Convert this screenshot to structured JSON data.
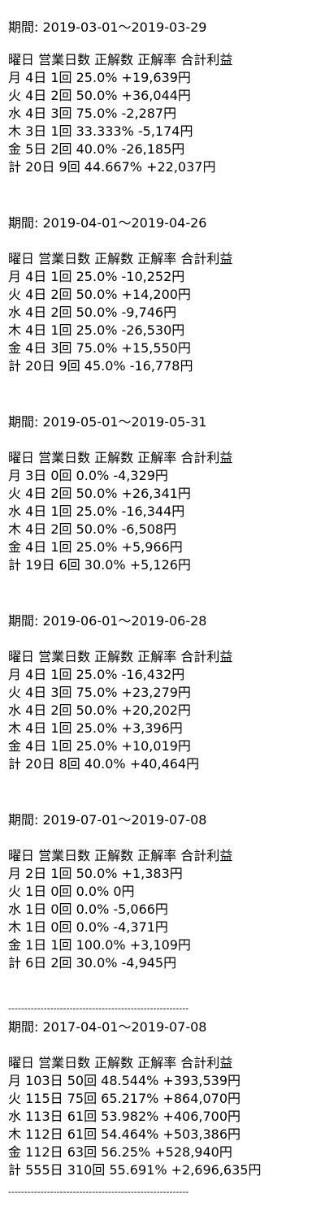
{
  "period_label": "期間:",
  "header": "曜日 営業日数 正解数 正解率 合計利益",
  "separator": "--------------------------------------------------------",
  "sections": [
    {
      "period": "2019-03-01〜2019-03-29",
      "rows": [
        "月 4日 1回 25.0% +19,639円",
        "火 4日 2回 50.0% +36,044円",
        "水 4日 3回 75.0% -2,287円",
        "木 3日 1回 33.333% -5,174円",
        "金 5日 2回 40.0% -26,185円",
        "計 20日 9回 44.667% +22,037円"
      ]
    },
    {
      "period": "2019-04-01〜2019-04-26",
      "rows": [
        "月 4日 1回 25.0% -10,252円",
        "火 4日 2回 50.0% +14,200円",
        "水 4日 2回 50.0% -9,746円",
        "木 4日 1回 25.0% -26,530円",
        "金 4日 3回 75.0% +15,550円",
        "計 20日 9回 45.0% -16,778円"
      ]
    },
    {
      "period": "2019-05-01〜2019-05-31",
      "rows": [
        "月 3日 0回 0.0% -4,329円",
        "火 4日 2回 50.0% +26,341円",
        "水 4日 1回 25.0% -16,344円",
        "木 4日 2回 50.0% -6,508円",
        "金 4日 1回 25.0% +5,966円",
        "計 19日 6回 30.0% +5,126円"
      ]
    },
    {
      "period": "2019-06-01〜2019-06-28",
      "rows": [
        "月 4日 1回 25.0% -16,432円",
        "火 4日 3回 75.0% +23,279円",
        "水 4日 2回 50.0% +20,202円",
        "木 4日 1回 25.0% +3,396円",
        "金 4日 1回 25.0% +10,019円",
        "計 20日 8回 40.0% +40,464円"
      ]
    },
    {
      "period": "2019-07-01〜2019-07-08",
      "rows": [
        "月 2日 1回 50.0% +1,383円",
        "火 1日 0回 0.0% 0円",
        "水 1日 0回 0.0% -5,066円",
        "木 1日 0回 0.0% -4,371円",
        "金 1日 1回 100.0% +3,109円",
        "計 6日 2回 30.0% -4,945円"
      ]
    },
    {
      "period": "2017-04-01〜2019-07-08",
      "rows": [
        "月 103日 50回 48.544% +393,539円",
        "火 115日 75回 65.217% +864,070円",
        "水 113日 61回 53.982% +406,700円",
        "木 112日 61回 54.464% +503,386円",
        "金 112日 63回 56.25% +528,940円",
        "計 555日 310回 55.691% +2,696,635円"
      ]
    }
  ]
}
